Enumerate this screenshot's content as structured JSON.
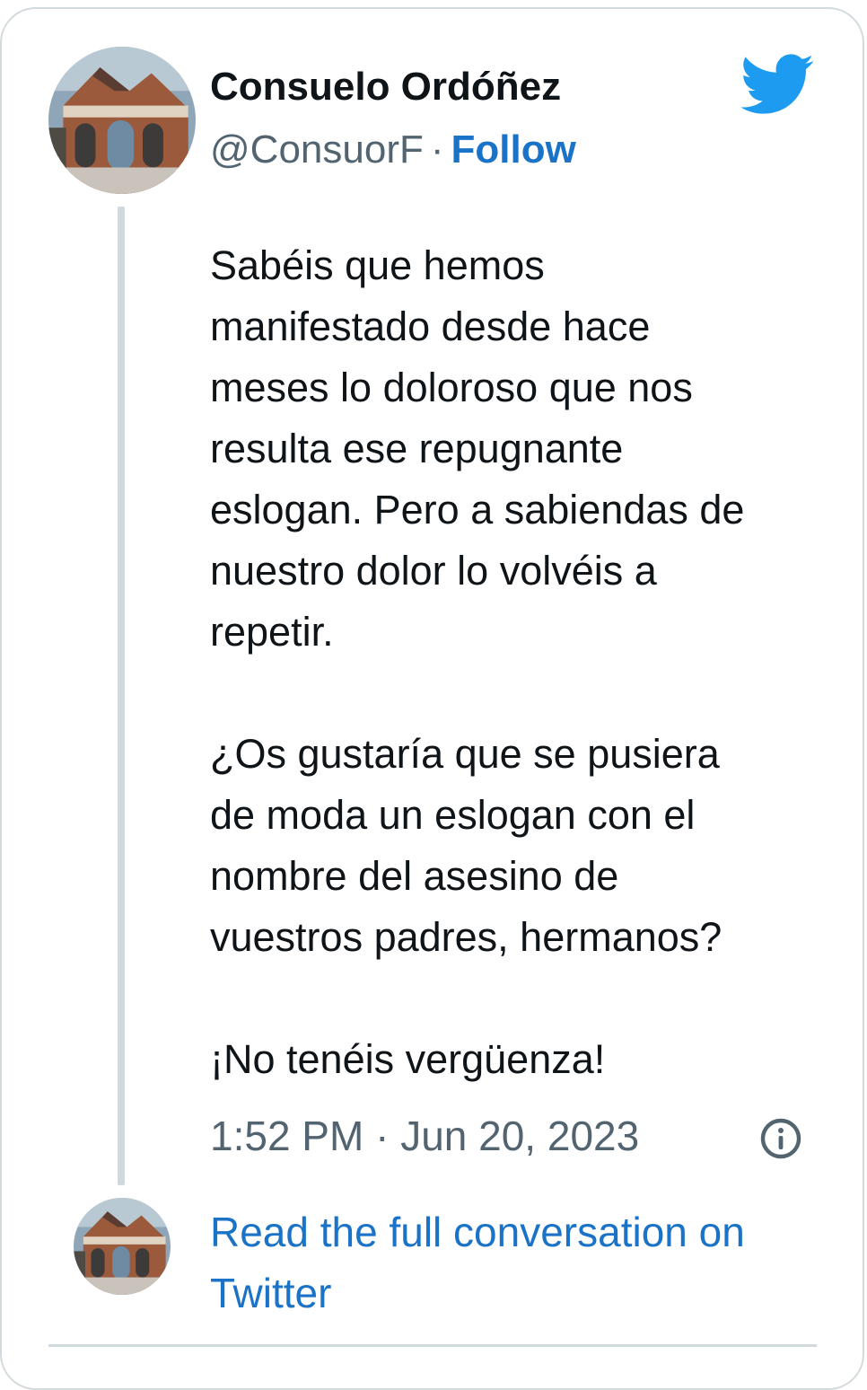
{
  "author": {
    "name": "Consuelo Ordóñez",
    "handle": "@ConsuorF",
    "separator": "·",
    "follow_label": "Follow"
  },
  "tweet": {
    "paragraph_1": "Sabéis que hemos\nmanifestado desde hace\nmeses lo doloroso que nos\nresulta ese repugnante\neslogan. Pero a sabiendas de\nnuestro dolor lo volvéis a\nrepetir.",
    "paragraph_2": "¿Os gustaría que se pusiera\nde moda un eslogan con el\nnombre del asesino de\nvuestros padres, hermanos?",
    "paragraph_3": "¡No tenéis vergüenza!",
    "timestamp": "1:52 PM · Jun 20, 2023"
  },
  "footer": {
    "read_full_label": "Read the full conversation on Twitter"
  },
  "icons": {
    "brand": "twitter-bird-icon",
    "info": "info-icon"
  },
  "colors": {
    "twitter_blue": "#1d9bf0",
    "link_blue": "#1a73c7",
    "text": "#0f1419",
    "muted": "#536471",
    "border": "#d3dade"
  }
}
